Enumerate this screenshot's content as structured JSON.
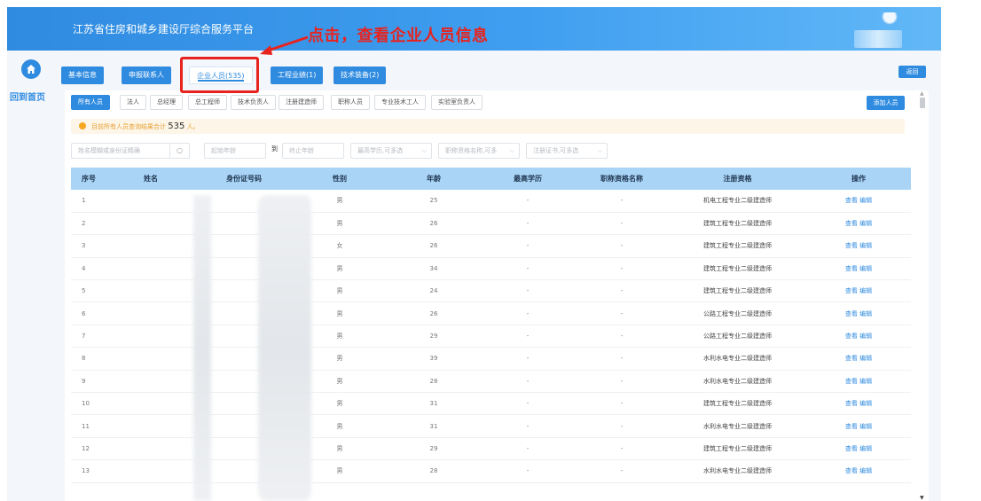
{
  "header": {
    "title": "江苏省住房和城乡建设厅综合服务平台"
  },
  "annotation": {
    "text": "点击，查看企业人员信息"
  },
  "sidebar": {
    "home_label": "回到首页"
  },
  "tabs": [
    {
      "label": "基本信息"
    },
    {
      "label": "申报联系人"
    },
    {
      "label": "企业人员(535)"
    },
    {
      "label": "工程业绩(1)"
    },
    {
      "label": "技术装备(2)"
    }
  ],
  "back_label": "返回",
  "filters": [
    {
      "label": "所有人员"
    },
    {
      "label": "法人"
    },
    {
      "label": "总经理"
    },
    {
      "label": "总工程师"
    },
    {
      "label": "技术负责人"
    },
    {
      "label": "注册建造师"
    },
    {
      "label": "职称人员"
    },
    {
      "label": "专业技术工人"
    },
    {
      "label": "实验室负责人"
    }
  ],
  "add_label": "添加人员",
  "notice": {
    "prefix": "目前所有人员查询结果合计",
    "count": "535",
    "suffix": "人。"
  },
  "search": {
    "name_placeholder": "姓名模糊或身份证精确",
    "age_from_placeholder": "起始年龄",
    "to_label": "到",
    "age_to_placeholder": "终止年龄",
    "education_placeholder": "最高学历,可多选",
    "title_placeholder": "职称资格名称,可多",
    "cert_placeholder": "注册证书,可多选"
  },
  "table": {
    "columns": [
      "序号",
      "姓名",
      "身份证号码",
      "性别",
      "年龄",
      "最高学历",
      "职称资格名称",
      "注册资格",
      "操作"
    ],
    "rows": [
      {
        "idx": "1",
        "gender": "男",
        "age": "25",
        "edu": "-",
        "title": "-",
        "qual": "机电工程专业二级建造师"
      },
      {
        "idx": "2",
        "gender": "男",
        "age": "26",
        "edu": "-",
        "title": "-",
        "qual": "建筑工程专业二级建造师"
      },
      {
        "idx": "3",
        "gender": "女",
        "age": "26",
        "edu": "-",
        "title": "-",
        "qual": "建筑工程专业二级建造师"
      },
      {
        "idx": "4",
        "gender": "男",
        "age": "34",
        "edu": "-",
        "title": "-",
        "qual": "建筑工程专业二级建造师"
      },
      {
        "idx": "5",
        "gender": "男",
        "age": "24",
        "edu": "-",
        "title": "-",
        "qual": "建筑工程专业二级建造师"
      },
      {
        "idx": "6",
        "gender": "男",
        "age": "26",
        "edu": "-",
        "title": "-",
        "qual": "公路工程专业二级建造师"
      },
      {
        "idx": "7",
        "gender": "男",
        "age": "29",
        "edu": "-",
        "title": "-",
        "qual": "公路工程专业二级建造师"
      },
      {
        "idx": "8",
        "gender": "男",
        "age": "39",
        "edu": "-",
        "title": "-",
        "qual": "水利水电专业二级建造师"
      },
      {
        "idx": "9",
        "gender": "男",
        "age": "28",
        "edu": "-",
        "title": "-",
        "qual": "水利水电专业二级建造师"
      },
      {
        "idx": "10",
        "gender": "男",
        "age": "31",
        "edu": "-",
        "title": "-",
        "qual": "建筑工程专业二级建造师"
      },
      {
        "idx": "11",
        "gender": "男",
        "age": "31",
        "edu": "-",
        "title": "-",
        "qual": "水利水电专业二级建造师"
      },
      {
        "idx": "12",
        "gender": "男",
        "age": "29",
        "edu": "-",
        "title": "-",
        "qual": "建筑工程专业二级建造师"
      },
      {
        "idx": "13",
        "gender": "男",
        "age": "28",
        "edu": "-",
        "title": "-",
        "qual": "水利水电专业二级建造师"
      }
    ],
    "view_label": "查看",
    "edit_label": "编辑"
  },
  "colors": {
    "primary": "#2f8be0",
    "annotation_red": "#e8231e",
    "table_header": "#a9d4f5",
    "notice_bg": "#fdf6e8"
  }
}
